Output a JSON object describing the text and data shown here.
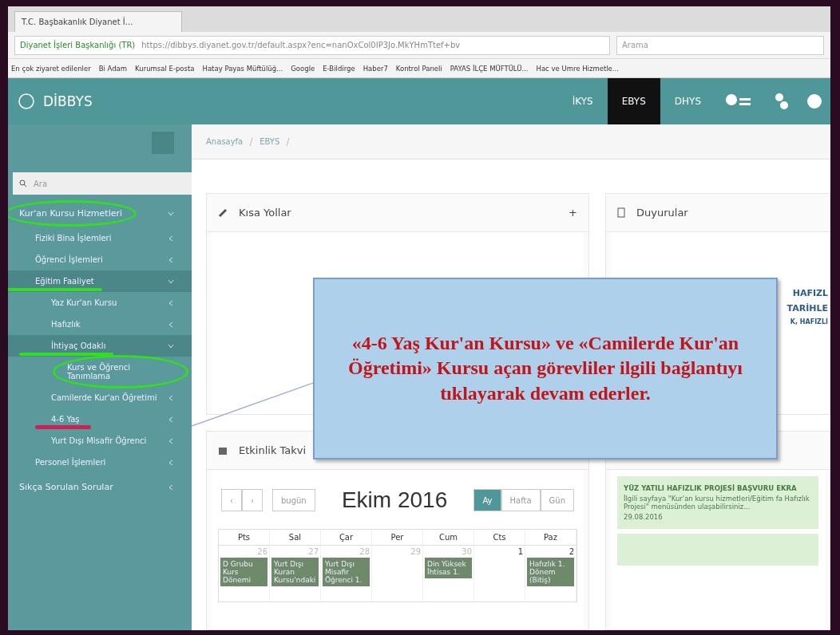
{
  "browser": {
    "tabs": [
      {
        "title": "T.C. Başbakanlık Diyanet İ...",
        "selected": true
      }
    ],
    "site_label": "Diyanet İşleri Başkanlığı (TR)",
    "url": "https://dibbys.diyanet.gov.tr/default.aspx?enc=nanOxCol0IP3Jo.MkYHmTtef+bv",
    "search_placeholder": "Arama",
    "bookmarks": [
      "En çok ziyaret edilenler",
      "Bi Adam",
      "Kurumsal E-posta",
      "Hatay Payas Müftülüğ...",
      "Google",
      "E-Bildirge",
      "Haber7",
      "Kontrol Paneli",
      "PAYAS İLÇE MÜFTÜLÜ...",
      "Hac ve Umre Hizmetle..."
    ]
  },
  "app": {
    "logo": "DİBBYS",
    "nav": [
      {
        "label": "İKYS",
        "selected": false
      },
      {
        "label": "EBYS",
        "selected": true
      },
      {
        "label": "DHYS",
        "selected": false
      }
    ]
  },
  "sidebar": {
    "search_placeholder": "Ara",
    "items": [
      {
        "label": "Kur'an Kursu Hizmetleri",
        "kind": "circled",
        "expanded": true,
        "children": [
          {
            "label": "Fiziki Bina İşlemleri",
            "kind": "plain",
            "expanded": false
          },
          {
            "label": "Öğrenci İşlemleri",
            "kind": "plain",
            "expanded": false
          },
          {
            "label": "Eğitim Faaliyet",
            "kind": "underlined",
            "expanded": true,
            "children": [
              {
                "label": "Yaz Kur'an Kursu",
                "kind": "plain",
                "expanded": false
              },
              {
                "label": "Hafızlık",
                "kind": "plain",
                "expanded": false
              },
              {
                "label": "İhtiyaç Odaklı",
                "kind": "underlined",
                "expanded": true,
                "children": [
                  {
                    "label": "Kurs ve Öğrenci Tanımlama",
                    "kind": "circled"
                  }
                ]
              },
              {
                "label": "Camilerde Kur'an Öğretimi",
                "kind": "plain",
                "expanded": false
              },
              {
                "label": "4-6 Yaş",
                "kind": "struck",
                "expanded": false
              },
              {
                "label": "Yurt Dışı Misafir Öğrenci",
                "kind": "plain",
                "expanded": false
              }
            ]
          },
          {
            "label": "Personel İşlemleri",
            "kind": "plain",
            "expanded": false
          }
        ]
      },
      {
        "label": "Sıkça Sorulan Sorular",
        "kind": "plain",
        "expanded": false
      }
    ]
  },
  "breadcrumb": [
    "Anasayfa",
    "EBYS"
  ],
  "shortcuts": {
    "title": "Kısa Yollar",
    "add": "+"
  },
  "announcements": {
    "title": "Duyurular",
    "lines": [
      "HAFIZL",
      "TARİHLE",
      "K, HAFIZLI"
    ]
  },
  "calendar": {
    "title": "Etkinlik Takvi",
    "prev": "‹",
    "next": "›",
    "today": "bugün",
    "month": "Ekim 2016",
    "views": [
      {
        "label": "Ay",
        "selected": true
      },
      {
        "label": "Hafta",
        "selected": false
      },
      {
        "label": "Gün",
        "selected": false
      }
    ],
    "days": [
      "Pts",
      "Sal",
      "Çar",
      "Per",
      "Cum",
      "Cts",
      "Paz"
    ],
    "dates": [
      {
        "day": "26",
        "event": "D Grubu Kurs Dönemi",
        "muted": true
      },
      {
        "day": "27",
        "event": "Yurt Dışı Kuran Kursu'ndaki",
        "muted": true
      },
      {
        "day": "28",
        "event": "Yurt Dışı Misafir Öğrenci 1.",
        "muted": true
      },
      {
        "day": "29",
        "muted": true
      },
      {
        "day": "30",
        "event": "Din Yüksek İhtisas 1.",
        "muted": true
      },
      {
        "day": "1",
        "muted": false
      },
      {
        "day": "2",
        "event": "Hafızlık 1. Dönem (Bitiş)",
        "muted": false
      }
    ]
  },
  "projects": {
    "cards": [
      {
        "title": "YÜZ YATILI HAFIZLIK PROJESİ BAŞVURU EKRA",
        "body": "İlgili sayfaya \"Kur'an kursu hizmetleri/Eğitim fa Hafızlık Projesi\" menüsünden ulaşabilirsiniz...",
        "date": "29.08.2016"
      }
    ]
  },
  "callout": {
    "text": "«4-6 Yaş Kur'an Kursu» ve «Camilerde Kur'an Öğretimi» Kursu açan görevliler ilgili bağlantıyı tıklayarak devam ederler."
  }
}
